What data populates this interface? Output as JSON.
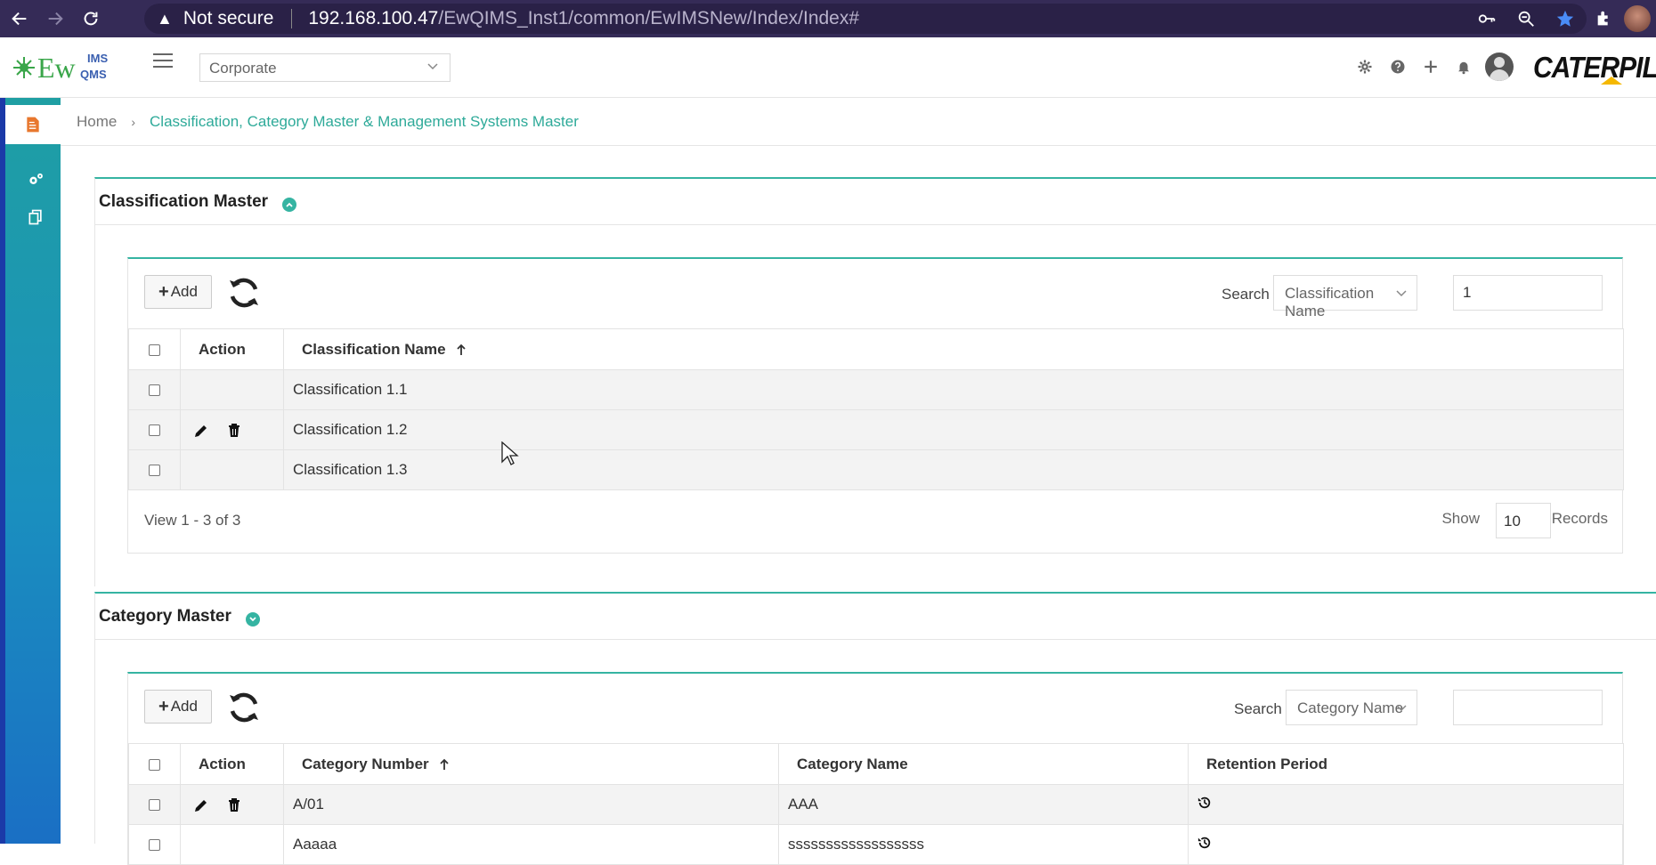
{
  "browser": {
    "security_label": "Not secure",
    "url_host": "192.168.100.47",
    "url_path": "/EwQIMS_Inst1/common/EwIMSNew/Index/Index#"
  },
  "header": {
    "logo_text": "Ew",
    "logo_sup": "IMS",
    "logo_sub": "QMS",
    "org_select": "Corporate",
    "brand": "CATERPILLA"
  },
  "breadcrumb": {
    "home": "Home",
    "current": "Classification, Category Master & Management Systems Master"
  },
  "classification": {
    "title": "Classification Master",
    "add_label": "Add",
    "search_label": "Search",
    "search_field": "Classification Name",
    "search_value": "1",
    "columns": [
      "Action",
      "Classification Name"
    ],
    "rows": [
      {
        "name": "Classification 1.1"
      },
      {
        "name": "Classification 1.2"
      },
      {
        "name": "Classification 1.3"
      }
    ],
    "view_text": "View 1 - 3 of 3",
    "show_label": "Show",
    "show_value": "10",
    "records_label": "Records"
  },
  "category": {
    "title": "Category Master",
    "add_label": "Add",
    "search_label": "Search",
    "search_field": "Category Name",
    "search_value": "",
    "columns": [
      "Action",
      "Category Number",
      "Category Name",
      "Retention Period"
    ],
    "rows": [
      {
        "number": "A/01",
        "name": "AAA"
      },
      {
        "number": "Aaaaa",
        "name": "ssssssssssssssssss"
      }
    ]
  },
  "colors": {
    "accent": "#35b4a2",
    "browser_bar": "#352b57",
    "sidebar_top": "#1f9fa3",
    "sidebar_bottom": "#1a6fc4"
  }
}
